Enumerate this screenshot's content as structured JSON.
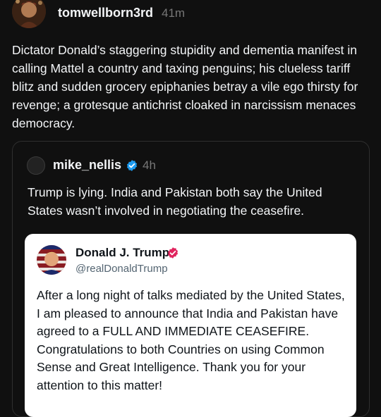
{
  "post": {
    "username": "tomwellborn3rd",
    "time": "41m",
    "text": "Dictator Donald’s staggering stupidity and dementia manifest in calling Mattel a country and taxing penguins; his clueless tariff blitz and sudden grocery epiphanies betray a vile ego thirsty for revenge; a grotesque antichrist cloaked in narcissism menaces democracy."
  },
  "quoted": {
    "username": "mike_nellis",
    "time": "4h",
    "text": "Trump is lying. India and Pakistan both say the United States wasn’t involved in negotiating the ceasefire.",
    "embedded": {
      "name": "Donald J. Trump",
      "handle": "@realDonaldTrump",
      "text": "After a long night of talks mediated by the United States, I am pleased to announce that India and Pakistan have agreed to a FULL AND IMMEDIATE CEASEFIRE. Congratulations to both Countries on using Common Sense and Great Intelligence. Thank you for your attention to this matter!"
    }
  },
  "colors": {
    "background": "#101010",
    "text_primary": "#f3f5f7",
    "text_secondary": "#777777",
    "verified_blue": "#1d9bf0",
    "trump_badge_pink": "#e0245e"
  },
  "icons": {
    "verified": "verified-check-icon",
    "trump_badge": "affiliation-badge-icon"
  }
}
